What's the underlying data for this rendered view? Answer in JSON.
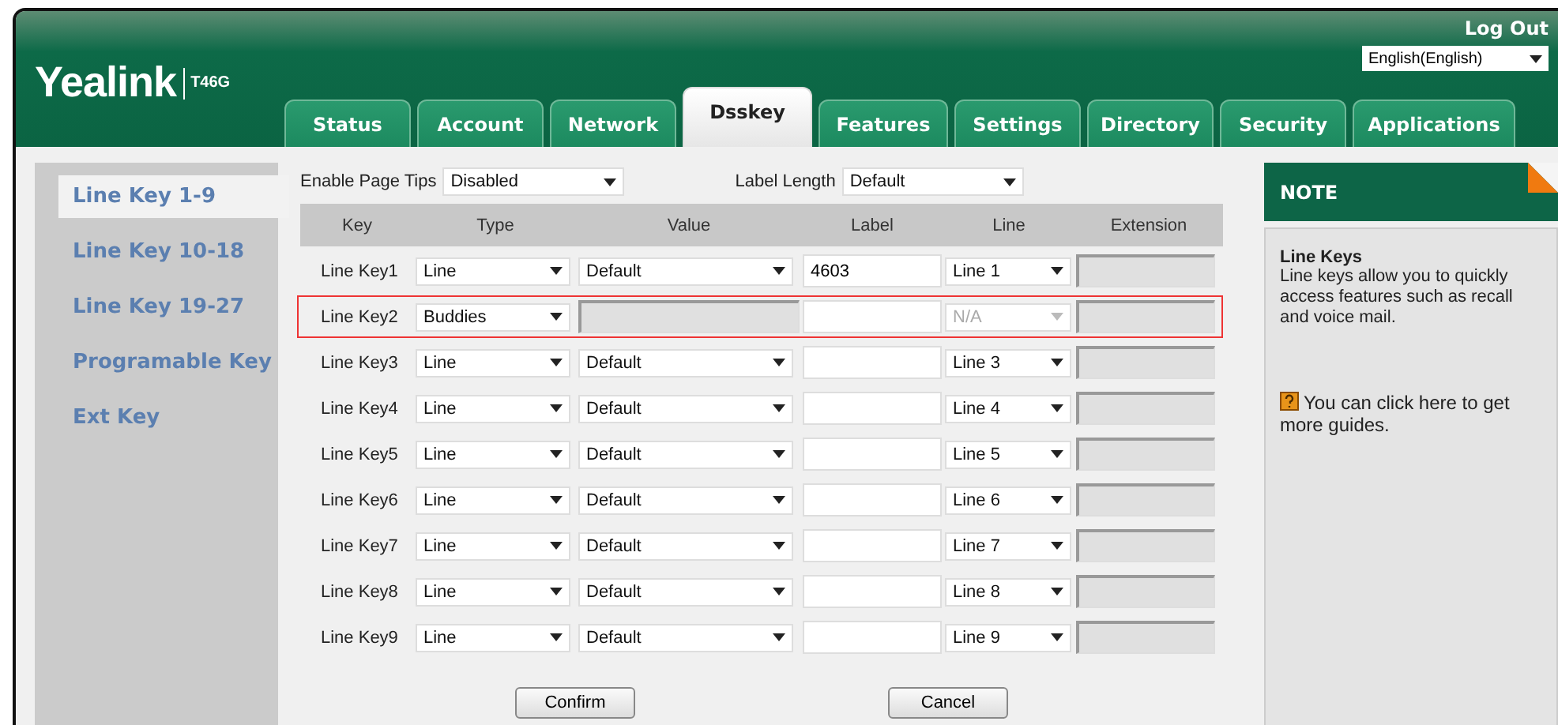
{
  "header": {
    "logo": "Yealink",
    "model": "T46G",
    "logout": "Log Out",
    "language": "English(English)"
  },
  "tabs": [
    {
      "label": "Status",
      "selected": false
    },
    {
      "label": "Account",
      "selected": false
    },
    {
      "label": "Network",
      "selected": false
    },
    {
      "label": "Dsskey",
      "selected": true
    },
    {
      "label": "Features",
      "selected": false
    },
    {
      "label": "Settings",
      "selected": false
    },
    {
      "label": "Directory",
      "selected": false
    },
    {
      "label": "Security",
      "selected": false
    },
    {
      "label": "Applications",
      "selected": false
    }
  ],
  "sidebar": {
    "items": [
      {
        "label": "Line Key 1-9",
        "selected": true
      },
      {
        "label": "Line Key 10-18",
        "selected": false
      },
      {
        "label": "Line Key 19-27",
        "selected": false
      },
      {
        "label": "Programable Key",
        "selected": false
      },
      {
        "label": "Ext Key",
        "selected": false
      }
    ]
  },
  "options": [
    {
      "label": "Enable Page Tips",
      "value": "Disabled"
    },
    {
      "label": "Label Length",
      "value": "Default"
    }
  ],
  "table": {
    "columns": [
      "Key",
      "Type",
      "Value",
      "Label",
      "Line",
      "Extension"
    ],
    "rows": [
      {
        "key": "Line Key1",
        "type": "Line",
        "value": {
          "kind": "select",
          "text": "Default"
        },
        "label": "4603",
        "line": {
          "text": "Line 1",
          "disabled": false
        },
        "highlighted": false
      },
      {
        "key": "Line Key2",
        "type": "Buddies",
        "value": {
          "kind": "field"
        },
        "line": {
          "text": "N/A",
          "disabled": true
        },
        "highlighted": true
      },
      {
        "key": "Line Key3",
        "type": "Line",
        "value": {
          "kind": "select",
          "text": "Default"
        },
        "line": {
          "text": "Line 3",
          "disabled": false
        },
        "highlighted": false
      },
      {
        "key": "Line Key4",
        "type": "Line",
        "value": {
          "kind": "select",
          "text": "Default"
        },
        "line": {
          "text": "Line 4",
          "disabled": false
        },
        "highlighted": false
      },
      {
        "key": "Line Key5",
        "type": "Line",
        "value": {
          "kind": "select",
          "text": "Default"
        },
        "line": {
          "text": "Line 5",
          "disabled": false
        },
        "highlighted": false
      },
      {
        "key": "Line Key6",
        "type": "Line",
        "value": {
          "kind": "select",
          "text": "Default"
        },
        "line": {
          "text": "Line 6",
          "disabled": false
        },
        "highlighted": false
      },
      {
        "key": "Line Key7",
        "type": "Line",
        "value": {
          "kind": "select",
          "text": "Default"
        },
        "line": {
          "text": "Line 7",
          "disabled": false
        },
        "highlighted": false
      },
      {
        "key": "Line Key8",
        "type": "Line",
        "value": {
          "kind": "select",
          "text": "Default"
        },
        "line": {
          "text": "Line 8",
          "disabled": false
        },
        "highlighted": false
      },
      {
        "key": "Line Key9",
        "type": "Line",
        "value": {
          "kind": "select",
          "text": "Default"
        },
        "line": {
          "text": "Line 9",
          "disabled": false
        },
        "highlighted": false
      }
    ]
  },
  "buttons": [
    "Confirm",
    "Cancel"
  ],
  "note": {
    "title": "NOTE",
    "heading": "Line Keys",
    "body": "Line keys allow you to quickly access features such as recall and voice mail.",
    "guide": "You can click here to get more guides."
  }
}
